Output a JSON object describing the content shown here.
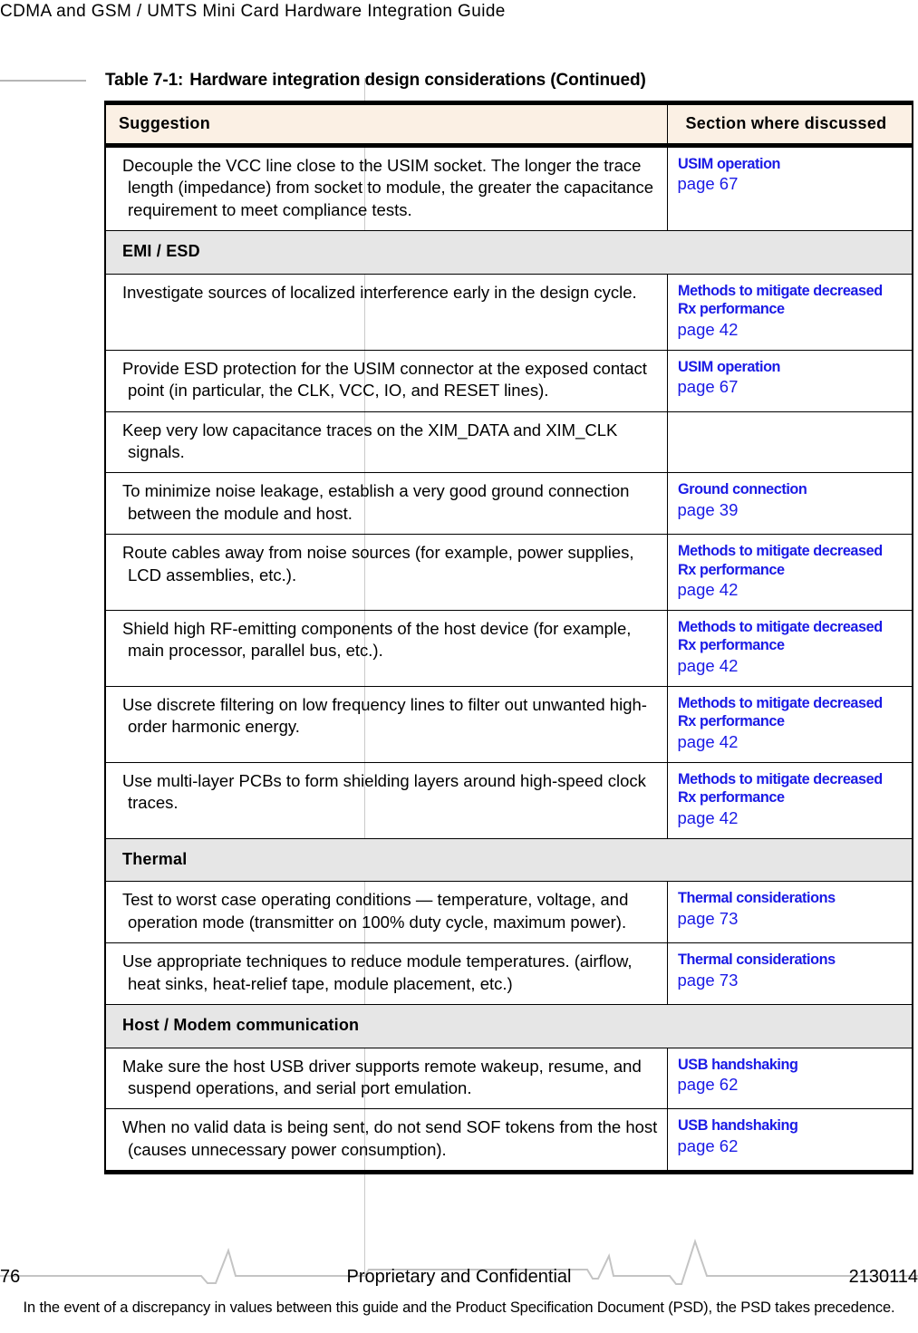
{
  "running_header": "CDMA and GSM / UMTS Mini Card Hardware Integration Guide",
  "table": {
    "caption_number": "Table 7-1:",
    "caption_text": "Hardware integration design considerations (Continued)",
    "columns": {
      "suggestion": "Suggestion",
      "section": "Section where discussed"
    },
    "rows": [
      {
        "type": "data",
        "suggestion": "Decouple the VCC line close to the USIM socket. The longer the trace length (impedance) from socket to module, the greater the capacitance requirement to meet compliance tests.",
        "link_title": "USIM operation",
        "link_page": "page 67"
      },
      {
        "type": "section",
        "label": "EMI / ESD"
      },
      {
        "type": "data",
        "suggestion": "Investigate sources of localized interference early in the design cycle.",
        "link_title": "Methods to mitigate decreased Rx performance",
        "link_page": "page 42"
      },
      {
        "type": "data",
        "suggestion": "Provide ESD protection for the USIM connector at the exposed contact point (in particular, the CLK, VCC, IO, and RESET lines).",
        "link_title": "USIM operation",
        "link_page": "page 67"
      },
      {
        "type": "data",
        "suggestion": "Keep very low capacitance traces on the XIM_DATA and XIM_CLK signals.",
        "link_title": "",
        "link_page": ""
      },
      {
        "type": "data",
        "suggestion": "To minimize noise leakage, establish a very good ground connection between the module and host.",
        "link_title": "Ground connection",
        "link_page": "page 39"
      },
      {
        "type": "data",
        "suggestion": "Route cables away from noise sources (for example, power supplies, LCD assemblies, etc.).",
        "link_title": "Methods to mitigate decreased Rx performance",
        "link_page": "page 42"
      },
      {
        "type": "data",
        "suggestion": "Shield high RF-emitting components of the host device (for example, main processor, parallel bus, etc.).",
        "link_title": "Methods to mitigate decreased Rx performance",
        "link_page": "page 42"
      },
      {
        "type": "data",
        "suggestion": "Use discrete filtering on low frequency lines to filter out unwanted high-order harmonic energy.",
        "link_title": "Methods to mitigate decreased Rx performance",
        "link_page": "page 42"
      },
      {
        "type": "data",
        "suggestion": "Use multi-layer PCBs to form shielding layers around high-speed clock traces.",
        "link_title": "Methods to mitigate decreased Rx performance",
        "link_page": "page 42"
      },
      {
        "type": "section",
        "label": "Thermal"
      },
      {
        "type": "data",
        "suggestion": "Test to worst case operating conditions — temperature, voltage, and operation mode (transmitter on 100% duty cycle, maximum power).",
        "link_title": "Thermal considerations",
        "link_page": "page 73"
      },
      {
        "type": "data",
        "suggestion": "Use appropriate techniques to reduce module temperatures. (airflow, heat sinks, heat-relief tape, module placement, etc.)",
        "link_title": "Thermal considerations",
        "link_page": "page 73"
      },
      {
        "type": "section",
        "label": "Host / Modem communication"
      },
      {
        "type": "data",
        "suggestion": "Make sure the host USB driver supports remote wakeup, resume, and suspend operations, and serial port emulation.",
        "link_title": "USB handshaking",
        "link_page": "page 62"
      },
      {
        "type": "data",
        "suggestion": "When no valid data is being sent, do not send SOF tokens from the host (causes unnecessary power consumption).",
        "link_title": "USB handshaking",
        "link_page": "page 62"
      }
    ]
  },
  "footer": {
    "page_number": "76",
    "center_text": "Proprietary and Confidential",
    "document_number": "2130114",
    "note": "In the event of a discrepancy in values between this guide and the Product Specification Document (PSD), the PSD takes precedence."
  },
  "colors": {
    "link": "#1a1ae6",
    "header_fill": "#fbf0e4",
    "section_fill": "#e6e6e6",
    "rule": "#b5b5b5"
  }
}
